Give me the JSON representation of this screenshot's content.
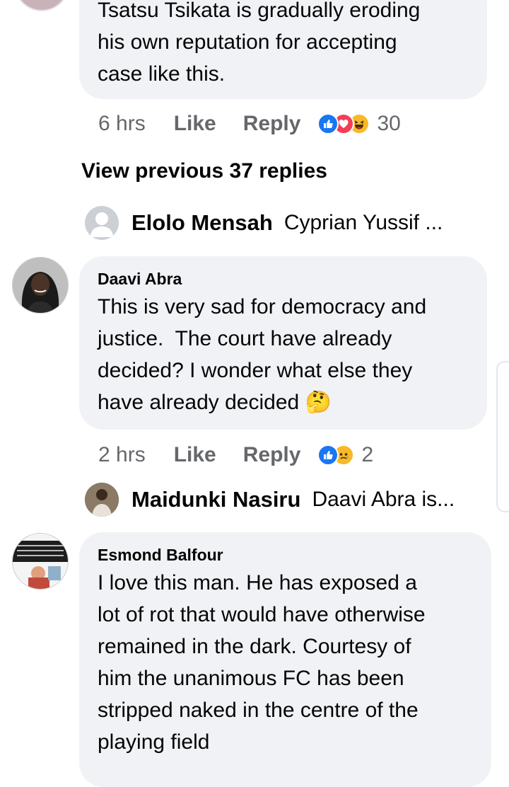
{
  "comment0": {
    "lines": "Tsatsu Tsikata is gradually eroding\nhis own reputation for accepting\ncase like this.",
    "time": "6 hrs",
    "like": "Like",
    "reply": "Reply",
    "reaction_count": "30",
    "reactions": [
      "like-icon",
      "love-icon",
      "haha-icon"
    ]
  },
  "view_previous": "View previous 37 replies",
  "reply1": {
    "name": "Elolo Mensah",
    "text": "Cyprian Yussif ..."
  },
  "comment1": {
    "author": "Daavi Abra",
    "lines": "This is very sad for democracy and\njustice.  The court have already\ndecided? I wonder what else they\nhave already decided ",
    "emoji": "🤔",
    "time": "2 hrs",
    "like": "Like",
    "reply": "Reply",
    "reaction_count": "2",
    "reactions": [
      "like-icon",
      "sad-icon"
    ]
  },
  "reply2": {
    "name": "Maidunki Nasiru",
    "text": "Daavi Abra is..."
  },
  "comment2": {
    "author": "Esmond Balfour",
    "lines": "I love this man. He has exposed a\nlot of rot that would have otherwise\nremained in the dark. Courtesy of\nhim the unanimous FC has been\nstripped naked in the centre of the\nplaying field"
  },
  "colors": {
    "bubble": "#f0f2f5",
    "meta_text": "#65676b",
    "like_blue": "#1877f2",
    "love_red": "#f33e58",
    "haha_yellow": "#f7b928"
  }
}
